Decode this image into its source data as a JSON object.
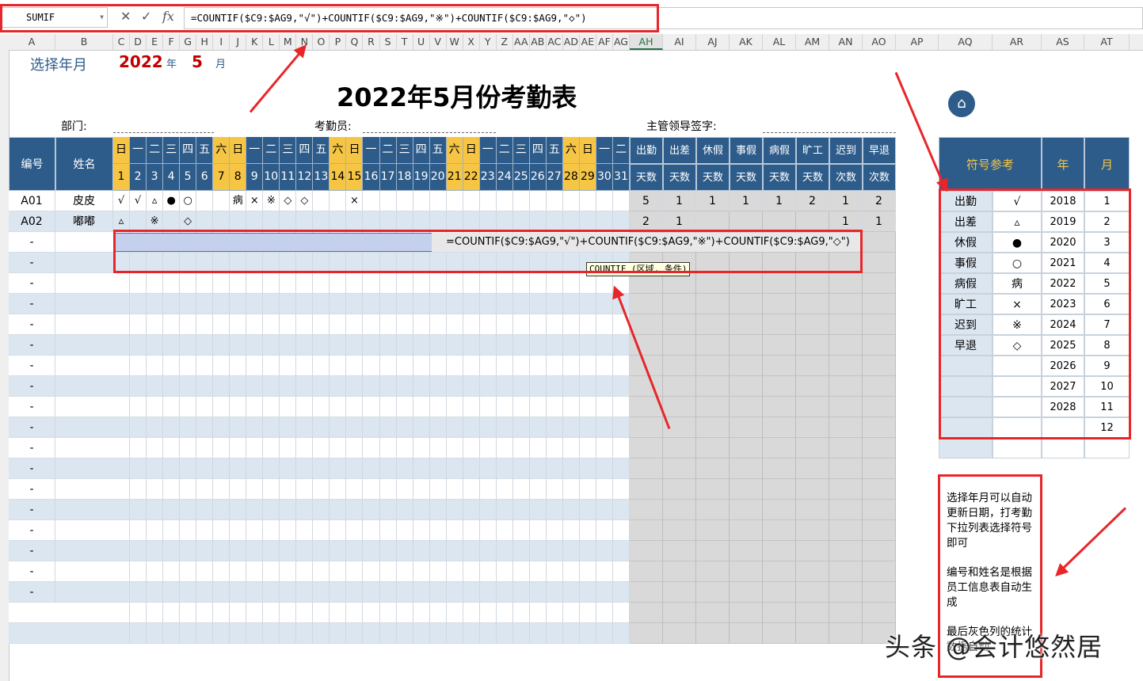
{
  "formula_bar": {
    "name_box": "SUMIF",
    "cancel_icon": "✕",
    "enter_icon": "✓",
    "fx_icon": "fx",
    "formula": "=COUNTIF($C9:$AG9,\"√\")+COUNTIF($C9:$AG9,\"※\")+COUNTIF($C9:$AG9,\"◇\")"
  },
  "columns": [
    "A",
    "B",
    "C",
    "D",
    "E",
    "F",
    "G",
    "H",
    "I",
    "J",
    "K",
    "L",
    "M",
    "N",
    "O",
    "P",
    "Q",
    "R",
    "S",
    "T",
    "U",
    "V",
    "W",
    "X",
    "Y",
    "Z",
    "AA",
    "AB",
    "AC",
    "AD",
    "AE",
    "AF",
    "AG",
    "AH",
    "AI",
    "AJ",
    "AK",
    "AL",
    "AM",
    "AN",
    "AO",
    "AP",
    "AQ",
    "AR",
    "AS",
    "AT"
  ],
  "selected_column": "AH",
  "sheet": {
    "select_label": "选择年月",
    "year": "2022",
    "year_unit": "年",
    "month": "5",
    "month_unit": "月",
    "title": "2022年5月份考勤表",
    "dept_label": "部门:",
    "clerk_label": "考勤员:",
    "supervisor_label": "主管领导签字:",
    "hdr_id": "编号",
    "hdr_name": "姓名",
    "weekdays": [
      "日",
      "一",
      "二",
      "三",
      "四",
      "五",
      "六",
      "日",
      "一",
      "二",
      "三",
      "四",
      "五",
      "六",
      "日",
      "一",
      "二",
      "三",
      "四",
      "五",
      "六",
      "日",
      "一",
      "二",
      "三",
      "四",
      "五",
      "六",
      "日",
      "一",
      "二"
    ],
    "days": [
      "1",
      "2",
      "3",
      "4",
      "5",
      "6",
      "7",
      "8",
      "9",
      "10",
      "11",
      "12",
      "13",
      "14",
      "15",
      "16",
      "17",
      "18",
      "19",
      "20",
      "21",
      "22",
      "23",
      "24",
      "25",
      "26",
      "27",
      "28",
      "29",
      "30",
      "31"
    ],
    "summary_headers": [
      {
        "top": "出勤",
        "bottom": "天数"
      },
      {
        "top": "出差",
        "bottom": "天数"
      },
      {
        "top": "休假",
        "bottom": "天数"
      },
      {
        "top": "事假",
        "bottom": "天数"
      },
      {
        "top": "病假",
        "bottom": "天数"
      },
      {
        "top": "旷工",
        "bottom": "天数"
      },
      {
        "top": "迟到",
        "bottom": "次数"
      },
      {
        "top": "早退",
        "bottom": "次数"
      }
    ],
    "rows": [
      {
        "id": "A01",
        "name": "皮皮",
        "marks": [
          "√",
          "√",
          "▵",
          "●",
          "○",
          "",
          "",
          "病",
          "×",
          "※",
          "◇",
          "◇",
          "",
          "",
          "×",
          "",
          "",
          "",
          "",
          "",
          "",
          "",
          "",
          "",
          "",
          "",
          "",
          "",
          "",
          "",
          ""
        ],
        "summary": [
          "5",
          "1",
          "1",
          "1",
          "1",
          "2",
          "1",
          "2"
        ]
      },
      {
        "id": "A02",
        "name": "嘟嘟",
        "marks": [
          "▵",
          "",
          "※",
          "",
          "◇",
          "",
          "",
          "",
          "",
          "",
          "",
          "",
          "",
          "",
          "",
          "",
          "",
          "",
          "",
          "",
          "",
          "",
          "",
          "",
          "",
          "",
          "",
          "",
          "",
          "",
          ""
        ],
        "summary": [
          "2",
          "1",
          "",
          "",
          "",
          "",
          "1",
          "1"
        ]
      }
    ],
    "placeholder_id": "-",
    "editing_formula": "=COUNTIF($C9:$AG9,\"√\")+COUNTIF($C9:$AG9,\"※\")+COUNTIF($C9:$AG9,\"◇\")",
    "tooltip": "COUNTIF (区域, 条件)"
  },
  "reference": {
    "home_icon": "home-icon",
    "hdr_symbol": "符号参考",
    "hdr_year": "年",
    "hdr_month": "月",
    "items": [
      {
        "label": "出勤",
        "symbol": "√"
      },
      {
        "label": "出差",
        "symbol": "▵"
      },
      {
        "label": "休假",
        "symbol": "●"
      },
      {
        "label": "事假",
        "symbol": "○"
      },
      {
        "label": "病假",
        "symbol": "病"
      },
      {
        "label": "旷工",
        "symbol": "×"
      },
      {
        "label": "迟到",
        "symbol": "※"
      },
      {
        "label": "早退",
        "symbol": "◇"
      }
    ],
    "years": [
      "2018",
      "2019",
      "2020",
      "2021",
      "2022",
      "2023",
      "2024",
      "2025",
      "2026",
      "2027",
      "2028"
    ],
    "months": [
      "1",
      "2",
      "3",
      "4",
      "5",
      "6",
      "7",
      "8",
      "9",
      "10",
      "11",
      "12"
    ],
    "note1": "选择年月可以自动更新日期，打考勤下拉列表选择符号即可",
    "note2": "编号和姓名是根据员工信息表自动生成",
    "note3": "最后灰色列的统计数据自动"
  },
  "watermark": "头条 @会计悠然居",
  "colors": {
    "header_blue": "#2e5c8a",
    "weekend_yellow": "#f5c543",
    "stripe_blue": "#dce6f1",
    "annotation_red": "#e8262a",
    "title_red": "#c00000"
  }
}
